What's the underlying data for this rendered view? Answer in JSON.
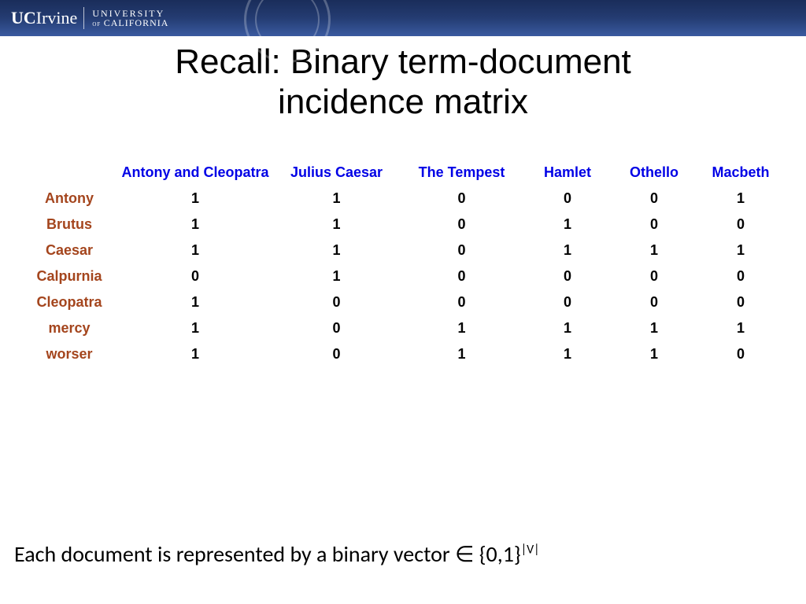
{
  "banner": {
    "uc": "UC",
    "irvine": "Irvine",
    "univ_line1": "UNIVERSITY",
    "univ_of": "of ",
    "univ_cal": "CALIFORNIA"
  },
  "title_line1": "Recall: Binary term-document",
  "title_line2": "incidence matrix",
  "chart_data": {
    "type": "table",
    "columns": [
      "Antony and Cleopatra",
      "Julius Caesar",
      "The Tempest",
      "Hamlet",
      "Othello",
      "Macbeth"
    ],
    "rows": [
      {
        "term": "Antony",
        "values": [
          1,
          1,
          0,
          0,
          0,
          1
        ]
      },
      {
        "term": "Brutus",
        "values": [
          1,
          1,
          0,
          1,
          0,
          0
        ]
      },
      {
        "term": "Caesar",
        "values": [
          1,
          1,
          0,
          1,
          1,
          1
        ]
      },
      {
        "term": "Calpurnia",
        "values": [
          0,
          1,
          0,
          0,
          0,
          0
        ]
      },
      {
        "term": "Cleopatra",
        "values": [
          1,
          0,
          0,
          0,
          0,
          0
        ]
      },
      {
        "term": "mercy",
        "values": [
          1,
          0,
          1,
          1,
          1,
          1
        ]
      },
      {
        "term": "worser",
        "values": [
          1,
          0,
          1,
          1,
          1,
          0
        ]
      }
    ]
  },
  "footnote": {
    "prefix": "Each document is represented by a binary vector ",
    "in": "∈",
    "set": " {0,1}",
    "sup": "|V|"
  }
}
